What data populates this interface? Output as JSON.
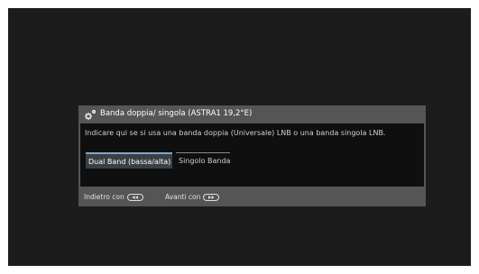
{
  "dialog": {
    "title": "Banda doppia/ singola (ASTRA1 19,2°E)",
    "title_icon": "settings-gears-icon",
    "description": "Indicare qui se si usa una banda doppia (Universale) LNB o una banda singola LNB.",
    "options": [
      {
        "label": "Dual Band (bassa/alta)",
        "selected": true
      },
      {
        "label": "Singolo Banda",
        "selected": false
      }
    ],
    "footer": {
      "back_label": "Indietro con",
      "back_icon": "rewind-button-icon",
      "next_label": "Avanti con",
      "next_icon": "fast-forward-button-icon"
    }
  },
  "colors": {
    "screen_background": "#1c1c1c",
    "dialog_frame": "#555555",
    "dialog_body": "#0f0f0f",
    "selection_accent": "#7aa8cf"
  }
}
